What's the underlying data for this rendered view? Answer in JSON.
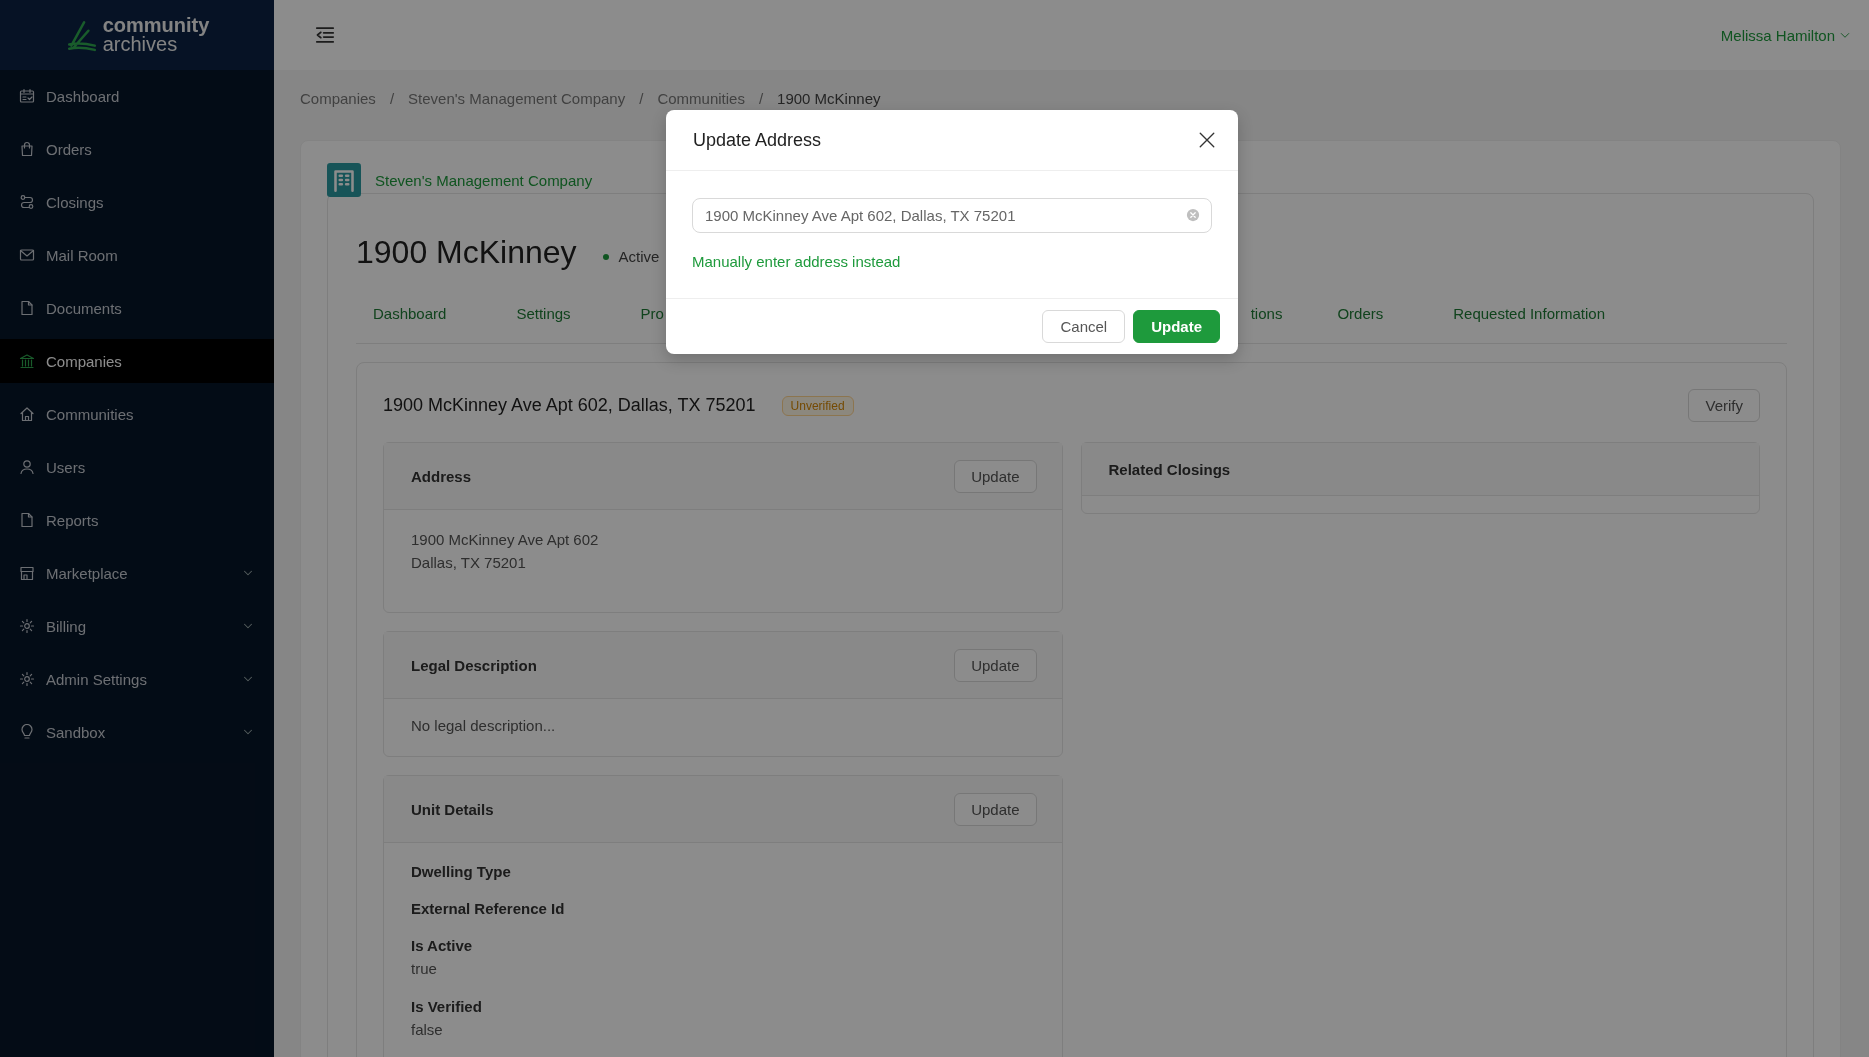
{
  "sidebar": {
    "logo": {
      "line1": "community",
      "line2": "archives"
    },
    "items": [
      {
        "label": "Dashboard",
        "selected": false,
        "expandable": false
      },
      {
        "label": "Orders",
        "selected": false,
        "expandable": false
      },
      {
        "label": "Closings",
        "selected": false,
        "expandable": false
      },
      {
        "label": "Mail Room",
        "selected": false,
        "expandable": false
      },
      {
        "label": "Documents",
        "selected": false,
        "expandable": false
      },
      {
        "label": "Companies",
        "selected": true,
        "expandable": false
      },
      {
        "label": "Communities",
        "selected": false,
        "expandable": false
      },
      {
        "label": "Users",
        "selected": false,
        "expandable": false
      },
      {
        "label": "Reports",
        "selected": false,
        "expandable": false
      },
      {
        "label": "Marketplace",
        "selected": false,
        "expandable": true
      },
      {
        "label": "Billing",
        "selected": false,
        "expandable": true
      },
      {
        "label": "Admin Settings",
        "selected": false,
        "expandable": true
      },
      {
        "label": "Sandbox",
        "selected": false,
        "expandable": true
      }
    ]
  },
  "header": {
    "user": "Melissa Hamilton"
  },
  "breadcrumbs": {
    "separator": "/",
    "items": [
      "Companies",
      "Steven's Management Company",
      "Communities",
      "1900 McKinney"
    ]
  },
  "company": {
    "name": "Steven's Management Company"
  },
  "community": {
    "title": "1900 McKinney",
    "status": "Active",
    "active": true
  },
  "tabs": [
    {
      "label": "Dashboard",
      "selected": false
    },
    {
      "label": "Settings",
      "selected": false
    },
    {
      "label": "Pro",
      "selected": false
    },
    {
      "label": "tions",
      "selected": false
    },
    {
      "label": "Orders",
      "selected": false
    },
    {
      "label": "Requested Information",
      "selected": false
    }
  ],
  "unit": {
    "address": "1900 McKinney Ave Apt 602, Dallas, TX 75201",
    "badge": "Unverified",
    "verify_button": "Verify",
    "panels": [
      {
        "kind": "address",
        "title": "Address",
        "button": "Update",
        "lines": [
          "1900 McKinney Ave Apt 602",
          "Dallas, TX 75201"
        ]
      },
      {
        "kind": "text",
        "title": "Legal Description",
        "button": "Update",
        "text": "No legal description..."
      },
      {
        "kind": "fields",
        "title": "Unit Details",
        "button": "Update",
        "fields": [
          {
            "label": "Dwelling Type"
          },
          {
            "label": "External Reference Id"
          },
          {
            "label": "Is Active",
            "value": "true"
          },
          {
            "label": "Is Verified",
            "value": "false"
          }
        ]
      }
    ],
    "related": {
      "title": "Related Closings"
    }
  },
  "modal": {
    "title": "Update Address",
    "value": "1900 McKinney Ave Apt 602, Dallas, TX 75201",
    "link": "Manually enter address instead",
    "buttons": [
      {
        "label": "Cancel",
        "kind": "secondary"
      },
      {
        "label": "Update",
        "kind": "primary"
      }
    ]
  }
}
